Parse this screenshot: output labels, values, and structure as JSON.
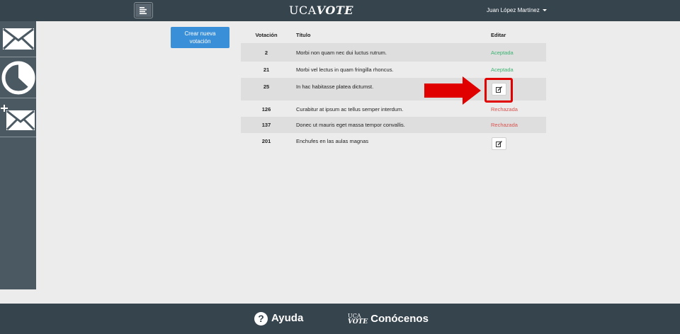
{
  "header": {
    "brand_part1": "UCA",
    "brand_part2": "VOTE",
    "user_name": "Juan López Martínez"
  },
  "sidebar": {
    "items": [
      {
        "icon": "envelope-icon"
      },
      {
        "icon": "pie-chart-icon"
      },
      {
        "icon": "new-envelope-icon"
      }
    ]
  },
  "actions": {
    "create_line1": "Crear nueva",
    "create_line2": "votación"
  },
  "table": {
    "headers": [
      "Votación",
      "Título",
      "Editar"
    ],
    "rows": [
      {
        "id": "2",
        "title": "Morbi non quam nec dui luctus rutrum.",
        "edit": "Aceptada",
        "edit_type": "status-accepted"
      },
      {
        "id": "21",
        "title": "Morbi vel lectus in quam fringilla rhoncus.",
        "edit": "Aceptada",
        "edit_type": "status-accepted"
      },
      {
        "id": "25",
        "title": "In hac habitasse platea dictumst.",
        "edit": "",
        "edit_type": "edit-button"
      },
      {
        "id": "126",
        "title": "Curabitur at ipsum ac tellus semper interdum.",
        "edit": "Rechazada",
        "edit_type": "status-rejected"
      },
      {
        "id": "137",
        "title": "Donec ut mauris eget massa tempor convallis.",
        "edit": "Rechazada",
        "edit_type": "status-rejected"
      },
      {
        "id": "201",
        "title": "Enchufes en las aulas magnas",
        "edit": "",
        "edit_type": "edit-button"
      }
    ]
  },
  "footer": {
    "help_label": "Ayuda",
    "about_logo_top": "UCA",
    "about_logo_bottom": "VOTE",
    "about_label": "Conócenos"
  },
  "colors": {
    "topbar": "#36444e",
    "sidebar": "#4b5963",
    "primary_button": "#3a8fd9",
    "accepted": "#3cb371",
    "rejected": "#d9534f",
    "annotation": "#e00000"
  }
}
